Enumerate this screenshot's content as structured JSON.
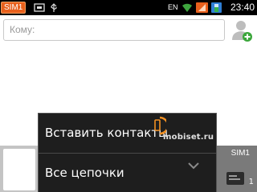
{
  "status_bar": {
    "sim_label": "SIM1",
    "network_label": "EN",
    "clock": "23:40",
    "icons": [
      "sim-toggle-icon",
      "usb-icon",
      "wifi-icon",
      "signal-icon",
      "battery-icon"
    ]
  },
  "recipient": {
    "placeholder": "Кому:"
  },
  "compose": {
    "sim_label": "SIM1",
    "message_count": "1"
  },
  "menu": {
    "items": [
      {
        "label": "Вставить контакты"
      },
      {
        "label": "Все цепочки"
      }
    ]
  },
  "watermark": {
    "text": "mobiset.ru"
  },
  "colors": {
    "status_bar_bg": "#000000",
    "sim_badge": "#e8601c",
    "menu_bg": "#1e1e1e",
    "compose_bg": "#c4c4c4",
    "send_area_bg": "#7a7a7a"
  }
}
